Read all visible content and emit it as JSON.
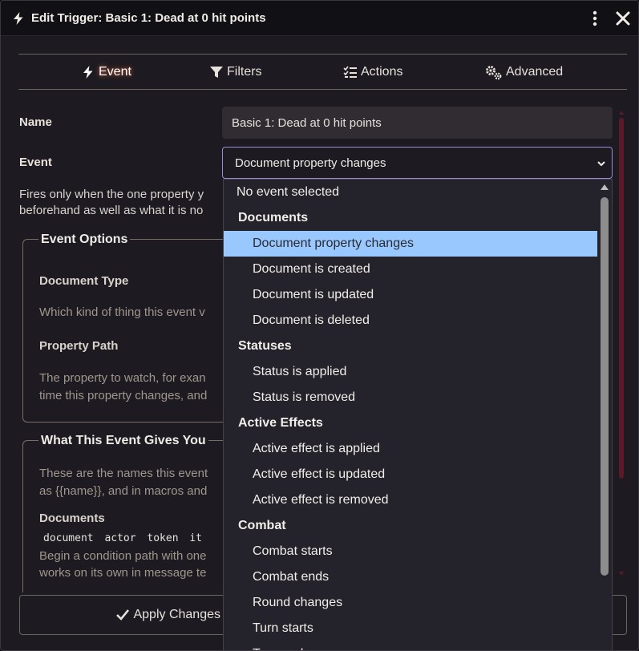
{
  "window": {
    "title": "Edit Trigger: Basic 1: Dead at 0 hit points",
    "menu_icon": "kebab-icon",
    "close_icon": "close-icon"
  },
  "tabs": [
    {
      "label": "Event",
      "icon": "bolt-icon",
      "active": true
    },
    {
      "label": "Filters",
      "icon": "funnel-icon",
      "active": false
    },
    {
      "label": "Actions",
      "icon": "list-check-icon",
      "active": false
    },
    {
      "label": "Advanced",
      "icon": "gears-icon",
      "active": false
    }
  ],
  "form": {
    "name_label": "Name",
    "name_value": "Basic 1: Dead at 0 hit points",
    "event_label": "Event",
    "event_value": "Document property changes",
    "event_description_line1": "Fires only when the one property y",
    "event_description_line2": "beforehand as well as what it is no"
  },
  "event_options": {
    "legend": "Event Options",
    "document_type_label": "Document Type",
    "document_type_help": "Which kind of thing this event v",
    "property_path_label": "Property Path",
    "property_path_help_line1": "The property to watch, for exan",
    "property_path_help_line2": "time this property changes, and"
  },
  "gives_you": {
    "legend": "What This Event Gives You",
    "intro_line1": "These are the names this event",
    "intro_line2": "as {{name}}, and in macros and",
    "documents_label": "Documents",
    "documents_list": "document actor token it",
    "hint_line1": "Begin a condition path with one",
    "hint_line2": "works on its own in message te"
  },
  "footer": {
    "apply_label": "Apply Changes"
  },
  "dropdown": {
    "options": [
      {
        "label": "No event selected",
        "kind": "top"
      },
      {
        "label": "Documents",
        "kind": "group"
      },
      {
        "label": "Document property changes",
        "kind": "sub",
        "selected": true
      },
      {
        "label": "Document is created",
        "kind": "sub"
      },
      {
        "label": "Document is updated",
        "kind": "sub"
      },
      {
        "label": "Document is deleted",
        "kind": "sub"
      },
      {
        "label": "Statuses",
        "kind": "group"
      },
      {
        "label": "Status is applied",
        "kind": "sub"
      },
      {
        "label": "Status is removed",
        "kind": "sub"
      },
      {
        "label": "Active Effects",
        "kind": "group"
      },
      {
        "label": "Active effect is applied",
        "kind": "sub"
      },
      {
        "label": "Active effect is updated",
        "kind": "sub"
      },
      {
        "label": "Active effect is removed",
        "kind": "sub"
      },
      {
        "label": "Combat",
        "kind": "group"
      },
      {
        "label": "Combat starts",
        "kind": "sub"
      },
      {
        "label": "Combat ends",
        "kind": "sub"
      },
      {
        "label": "Round changes",
        "kind": "sub"
      },
      {
        "label": "Turn starts",
        "kind": "sub"
      },
      {
        "label": "Turn ends",
        "kind": "sub"
      }
    ]
  },
  "colors": {
    "accent_glow": "#ff6a3c",
    "selected_option": "#99c8ff",
    "select_border": "#9c8bd6",
    "scroll_thumb": "#5a1a28"
  }
}
